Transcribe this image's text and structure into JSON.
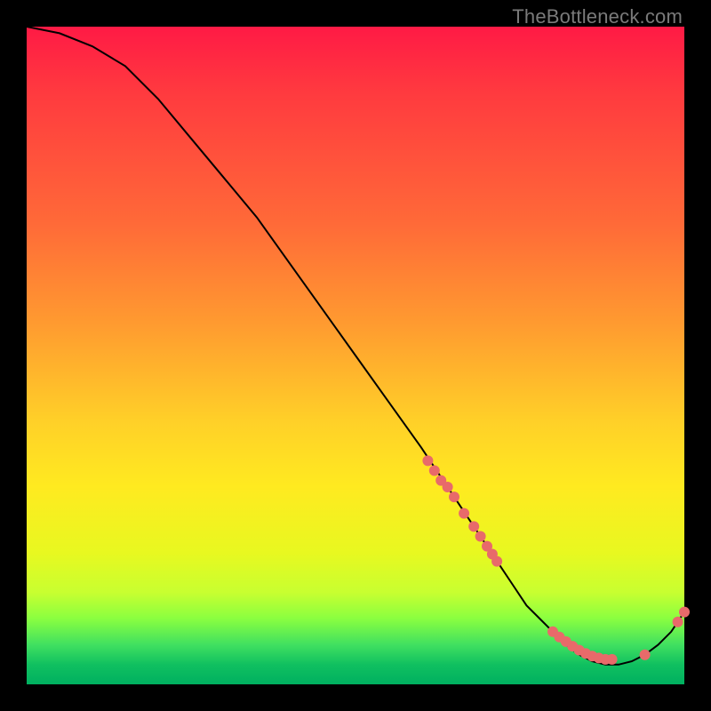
{
  "watermark": "TheBottleneck.com",
  "chart_data": {
    "type": "line",
    "title": "",
    "xlabel": "",
    "ylabel": "",
    "xlim": [
      0,
      100
    ],
    "ylim": [
      0,
      100
    ],
    "series": [
      {
        "name": "curve",
        "x": [
          0,
          5,
          10,
          15,
          20,
          25,
          30,
          35,
          40,
          45,
          50,
          55,
          60,
          62,
          64,
          66,
          68,
          70,
          72,
          74,
          76,
          78,
          80,
          82,
          84,
          86,
          88,
          90,
          92,
          94,
          96,
          98,
          100
        ],
        "values": [
          100,
          99,
          97,
          94,
          89,
          83,
          77,
          71,
          64,
          57,
          50,
          43,
          36,
          33,
          30,
          27,
          24,
          21,
          18,
          15,
          12,
          10,
          8,
          6,
          4.5,
          3.5,
          3,
          3,
          3.5,
          4.5,
          6,
          8,
          11
        ]
      }
    ],
    "markers": [
      {
        "x": 61,
        "y": 34
      },
      {
        "x": 62,
        "y": 32.5
      },
      {
        "x": 63,
        "y": 31
      },
      {
        "x": 64,
        "y": 30
      },
      {
        "x": 65,
        "y": 28.5
      },
      {
        "x": 66.5,
        "y": 26
      },
      {
        "x": 68,
        "y": 24
      },
      {
        "x": 69,
        "y": 22.5
      },
      {
        "x": 70,
        "y": 21
      },
      {
        "x": 70.8,
        "y": 19.8
      },
      {
        "x": 71.5,
        "y": 18.7
      },
      {
        "x": 80,
        "y": 8
      },
      {
        "x": 81,
        "y": 7.2
      },
      {
        "x": 82,
        "y": 6.5
      },
      {
        "x": 83,
        "y": 5.8
      },
      {
        "x": 84,
        "y": 5.2
      },
      {
        "x": 85,
        "y": 4.7
      },
      {
        "x": 86,
        "y": 4.3
      },
      {
        "x": 87,
        "y": 4.0
      },
      {
        "x": 88,
        "y": 3.8
      },
      {
        "x": 89,
        "y": 3.8
      },
      {
        "x": 94,
        "y": 4.5
      },
      {
        "x": 99,
        "y": 9.5
      },
      {
        "x": 100,
        "y": 11
      }
    ],
    "marker_color": "#e86a6a",
    "curve_color": "#000000"
  }
}
